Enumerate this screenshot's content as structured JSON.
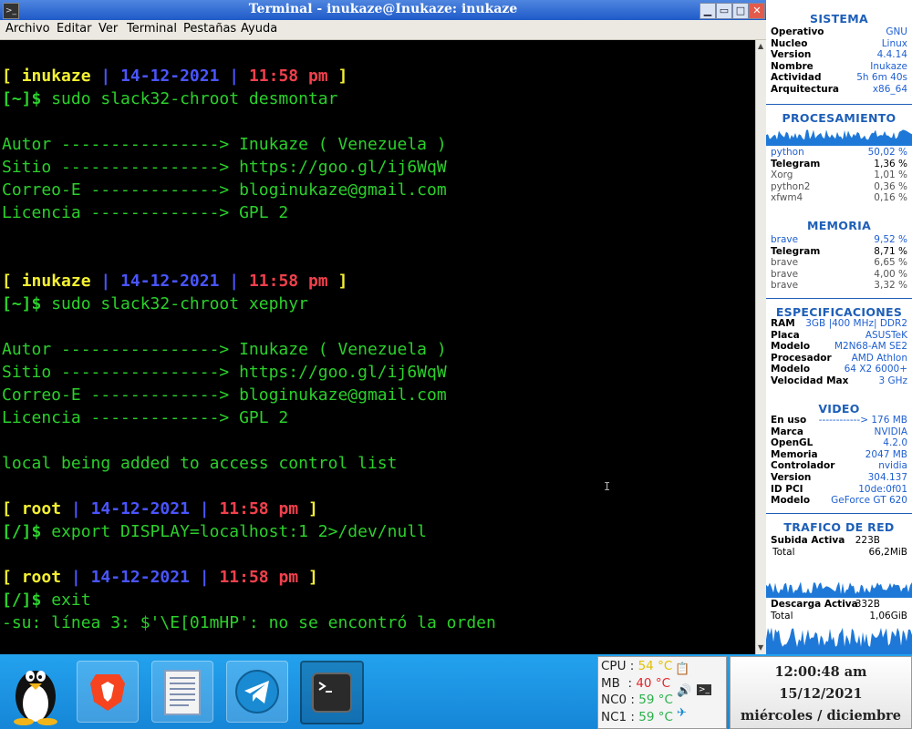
{
  "window": {
    "title": "Terminal - inukaze@Inukaze: inukaze",
    "app_icon": "terminal-icon",
    "minimize_glyph": "▁",
    "restore_glyph": "▭",
    "maximize_glyph": "□",
    "close_glyph": "✕",
    "menu": [
      "Archivo",
      "Editar",
      "Ver",
      "Terminal",
      "Pestañas",
      "Ayuda"
    ]
  },
  "terminal": {
    "lines": [
      {
        "type": "prompt",
        "user": "inukaze",
        "date": "14-12-2021",
        "time": "11:58 pm"
      },
      {
        "type": "cmd",
        "cwd": "[~]$ ",
        "command": "sudo slack32-chroot desmontar"
      },
      {
        "type": "blank"
      },
      {
        "type": "text",
        "text": "Autor ----------------> Inukaze ( Venezuela )"
      },
      {
        "type": "text",
        "text": "Sitio ----------------> https://goo.gl/ij6WqW"
      },
      {
        "type": "text",
        "text": "Correo-E -------------> bloginukaze@gmail.com"
      },
      {
        "type": "text",
        "text": "Licencia -------------> GPL 2"
      },
      {
        "type": "blank"
      },
      {
        "type": "blank"
      },
      {
        "type": "prompt",
        "user": "inukaze",
        "date": "14-12-2021",
        "time": "11:58 pm"
      },
      {
        "type": "cmd",
        "cwd": "[~]$ ",
        "command": "sudo slack32-chroot xephyr"
      },
      {
        "type": "blank"
      },
      {
        "type": "text",
        "text": "Autor ----------------> Inukaze ( Venezuela )"
      },
      {
        "type": "text",
        "text": "Sitio ----------------> https://goo.gl/ij6WqW"
      },
      {
        "type": "text",
        "text": "Correo-E -------------> bloginukaze@gmail.com"
      },
      {
        "type": "text",
        "text": "Licencia -------------> GPL 2"
      },
      {
        "type": "blank"
      },
      {
        "type": "text",
        "text": "local being added to access control list"
      },
      {
        "type": "blank"
      },
      {
        "type": "prompt",
        "user": "root",
        "date": "14-12-2021",
        "time": "11:58 pm"
      },
      {
        "type": "cmd",
        "cwd": "[/]$ ",
        "command": "export DISPLAY=localhost:1 2>/dev/null"
      },
      {
        "type": "blank"
      },
      {
        "type": "prompt",
        "user": "root",
        "date": "14-12-2021",
        "time": "11:58 pm"
      },
      {
        "type": "cmd",
        "cwd": "[/]$ ",
        "command": "exit"
      },
      {
        "type": "text",
        "text": "-su: línea 3: $'\\E[01mHP': no se encontró la orden"
      }
    ]
  },
  "conky": {
    "sistema": {
      "title": "SISTEMA",
      "rows": [
        {
          "label": "Operativo",
          "value": "GNU"
        },
        {
          "label": "Nucleo",
          "value": "Linux"
        },
        {
          "label": "Version",
          "value": "4.4.14"
        },
        {
          "label": "Nombre",
          "value": "Inukaze"
        },
        {
          "label": "Actividad",
          "value": "5h 6m 40s"
        },
        {
          "label": "Arquitectura",
          "value": "x86_64"
        }
      ]
    },
    "procesamiento": {
      "title": "PROCESAMIENTO",
      "rows": [
        {
          "label": "python",
          "value": "50,02 %",
          "style": "blue"
        },
        {
          "label": "Telegram",
          "value": "1,36 %",
          "style": "black"
        },
        {
          "label": "Xorg",
          "value": "1,01 %",
          "style": "gray"
        },
        {
          "label": "python2",
          "value": "0,36 %",
          "style": "gray"
        },
        {
          "label": "xfwm4",
          "value": "0,16 %",
          "style": "gray"
        }
      ]
    },
    "memoria": {
      "title": "MEMORIA",
      "rows": [
        {
          "label": "brave",
          "value": "9,52 %",
          "style": "blue"
        },
        {
          "label": "Telegram",
          "value": "8,71 %",
          "style": "black"
        },
        {
          "label": "brave",
          "value": "6,65 %",
          "style": "gray"
        },
        {
          "label": "brave",
          "value": "4,00 %",
          "style": "gray"
        },
        {
          "label": "brave",
          "value": "3,32 %",
          "style": "gray"
        }
      ]
    },
    "especificaciones": {
      "title": "ESPECIFICACIONES",
      "rows": [
        {
          "label": "RAM",
          "value": "3GB |400 MHz| DDR2"
        },
        {
          "label": "Placa",
          "value": "ASUSTeK"
        },
        {
          "label": "Modelo",
          "value": "M2N68-AM SE2"
        },
        {
          "label": "Procesador",
          "value": "AMD Athlon"
        },
        {
          "label": "Modelo",
          "value": "64 X2 6000+"
        },
        {
          "label": "Velocidad Max",
          "value": "3 GHz"
        }
      ]
    },
    "video": {
      "title": "VIDEO",
      "rows": [
        {
          "label": "En uso",
          "value": "------------> 176 MB"
        },
        {
          "label": "Marca",
          "value": "NVIDIA"
        },
        {
          "label": "OpenGL",
          "value": "4.2.0"
        },
        {
          "label": "Memoria",
          "value": "2047 MB"
        },
        {
          "label": "Controlador",
          "value": "nvidia"
        },
        {
          "label": "Version",
          "value": "304.137"
        },
        {
          "label": "ID PCI",
          "value": "10de:0f01"
        },
        {
          "label": "Modelo",
          "value": "GeForce GT 620"
        }
      ]
    },
    "red": {
      "title": "TRAFICO DE RED",
      "upload_label": "Subida Activa",
      "upload_value": "223B",
      "upload_total_label": "Total",
      "upload_total_value": "66,2MiB",
      "download_label": "Descarga Activa",
      "download_value": "332B",
      "download_total_label": "Total",
      "download_total_value": "1,06GiB"
    }
  },
  "taskbar": {
    "launchers": [
      {
        "name": "tux-menu-icon"
      },
      {
        "name": "brave-icon"
      },
      {
        "name": "text-editor-icon"
      },
      {
        "name": "telegram-icon"
      },
      {
        "name": "terminal-icon"
      }
    ],
    "sensors": [
      {
        "label": "CPU : ",
        "value": "54 °C"
      },
      {
        "label": "MB  : ",
        "value": "40 °C"
      },
      {
        "label": "NC0 : ",
        "value": "59 °C"
      },
      {
        "label": "NC1 : ",
        "value": "59 °C"
      }
    ],
    "tray_icons": [
      "clipboard-icon",
      "volume-icon",
      "telegram-tray-icon",
      "terminal-tray-icon"
    ],
    "clock": {
      "time": "12:00:48 am",
      "date": "15/12/2021",
      "day": "miércoles / diciembre"
    }
  },
  "colors": {
    "prompt_bracket": "#f4f032",
    "prompt_sep": "#4a55ff",
    "prompt_time": "#f0404c",
    "text": "#2bd02b",
    "conky_accent": "#1e5fb8",
    "taskbar": "#1e96e4"
  }
}
